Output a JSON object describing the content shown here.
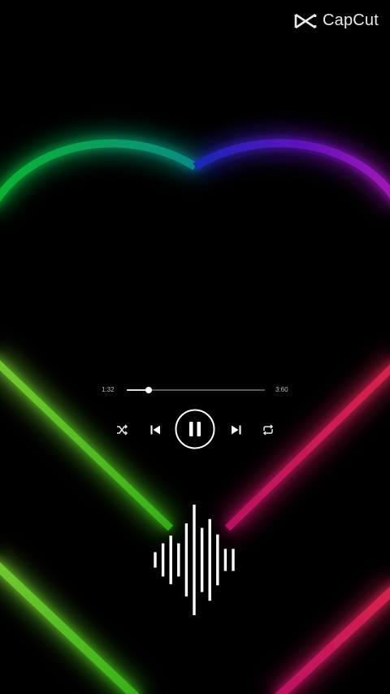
{
  "watermark": {
    "brand": "CapCut",
    "logo_icon": "capcut-logo-icon"
  },
  "player": {
    "time_elapsed": "1:32",
    "time_total": "3:60",
    "progress_fraction": 0.156,
    "is_playing": true,
    "controls": {
      "shuffle_icon": "shuffle-icon",
      "previous_icon": "skip-previous-icon",
      "pause_icon": "pause-icon",
      "next_icon": "skip-next-icon",
      "repeat_icon": "repeat-icon"
    }
  },
  "visualizer": {
    "levels": [
      0.14,
      0.3,
      0.44,
      0.3,
      0.66,
      1.0,
      0.58,
      0.74,
      0.46,
      0.2,
      0.2
    ]
  },
  "colors": {
    "background": "#000000",
    "foreground": "#ffffff",
    "heart_left": "#2ee84a",
    "heart_top_left": "#19c46a",
    "heart_top_right": "#b21ad9",
    "heart_right": "#ff1f6b"
  }
}
